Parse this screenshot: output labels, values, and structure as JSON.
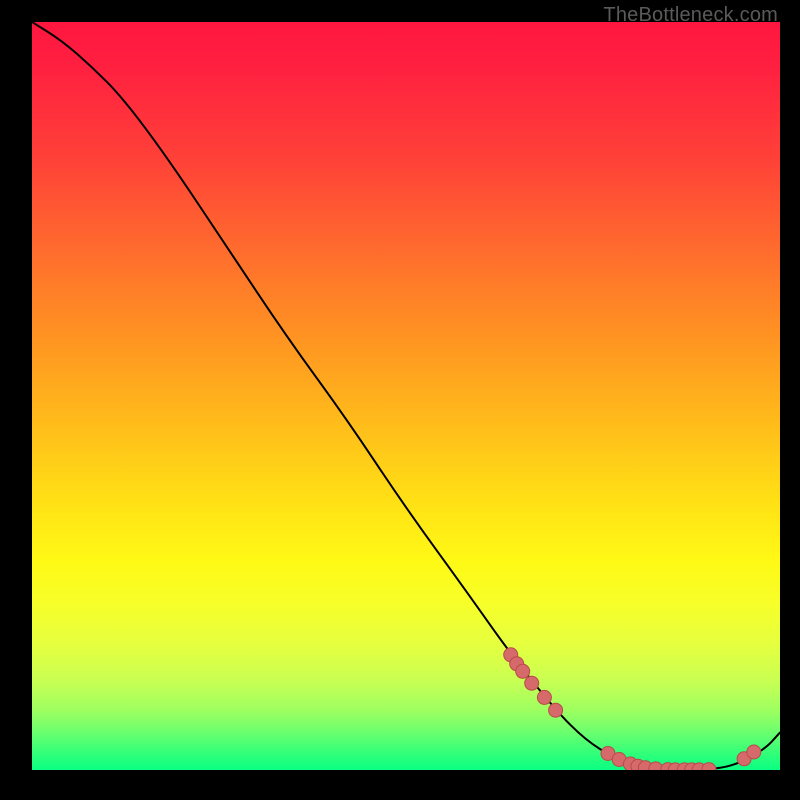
{
  "watermark": "TheBottleneck.com",
  "colors": {
    "marker_fill": "#d66a6a",
    "marker_stroke": "#b84a4a",
    "curve": "#000000"
  },
  "chart_data": {
    "type": "line",
    "title": "",
    "xlabel": "",
    "ylabel": "",
    "xlim": [
      0,
      100
    ],
    "ylim": [
      0,
      100
    ],
    "curve": {
      "x": [
        0,
        4,
        8,
        12,
        18,
        26,
        34,
        42,
        50,
        58,
        64,
        70,
        74,
        78,
        82,
        86,
        90,
        94,
        98,
        100
      ],
      "y": [
        100,
        97.5,
        94,
        90,
        82,
        70,
        58,
        47,
        35,
        24,
        15.5,
        8,
        4,
        1.5,
        0.2,
        0,
        0,
        0.6,
        2.8,
        5
      ]
    },
    "markers": {
      "x_pct": [
        64.0,
        64.8,
        65.6,
        66.8,
        68.5,
        70.0,
        77.0,
        78.5,
        80.0,
        81.0,
        82.0,
        83.4,
        85.0,
        86.0,
        87.2,
        88.2,
        89.2,
        90.5,
        95.2,
        96.5
      ],
      "y_pct": [
        15.4,
        14.2,
        13.2,
        11.6,
        9.7,
        8.0,
        2.2,
        1.4,
        0.8,
        0.5,
        0.3,
        0.15,
        0.05,
        0.02,
        0.01,
        0.01,
        0.02,
        0.06,
        1.5,
        2.4
      ]
    }
  }
}
